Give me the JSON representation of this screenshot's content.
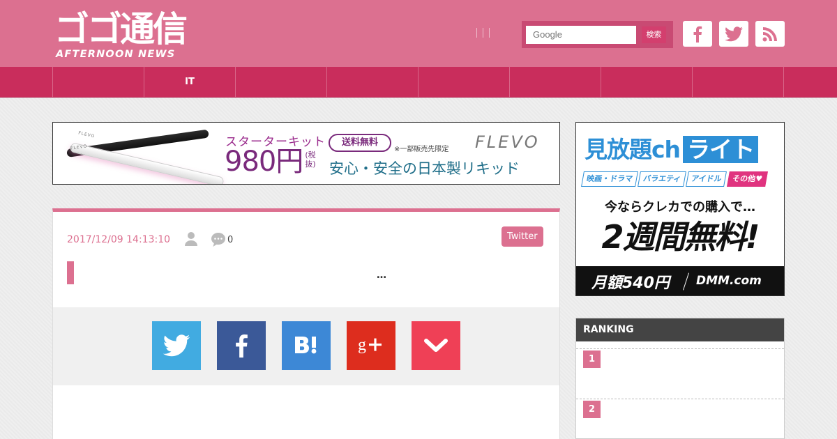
{
  "brand": {
    "logo_jp": "ゴゴ通信",
    "logo_en": "AFTERNOON NEWS"
  },
  "search": {
    "placeholder": "Google",
    "button_label": "検索"
  },
  "social_links": [
    {
      "name": "facebook",
      "icon": "facebook-icon"
    },
    {
      "name": "twitter",
      "icon": "twitter-icon"
    },
    {
      "name": "rss",
      "icon": "rss-icon"
    }
  ],
  "nav": {
    "items": [
      "",
      "IT",
      "",
      "",
      "",
      "",
      "",
      "",
      ""
    ]
  },
  "ads": {
    "banner": {
      "pen_label": "FLEVO",
      "kit_label": "スターターキット",
      "price": "980円",
      "tax_note": "(税抜)",
      "free_shipping": "送料無料",
      "limited_note": "※一部販売先限定",
      "brand": "FLEVO",
      "tagline": "安心・安全の日本製リキッド"
    },
    "side": {
      "title_main": "見放題ch",
      "title_lite": "ライト",
      "tags": [
        "映画・ドラマ",
        "バラエティ",
        "アイドル",
        "その他♥"
      ],
      "offer_line": "今ならクレカでの購入で…",
      "big_line": "2週間無料!",
      "monthly_price": "月額540円",
      "provider": "DMM.com"
    }
  },
  "article": {
    "date": "2017/12/09 14:13:10",
    "comment_count": "0",
    "source_tag": "Twitter",
    "title": "…"
  },
  "share_buttons": [
    {
      "name": "twitter",
      "icon": "twitter-icon",
      "color": "#41abe1"
    },
    {
      "name": "facebook",
      "icon": "facebook-icon",
      "color": "#3b5998"
    },
    {
      "name": "hatena",
      "icon": "hatena-bookmark-icon",
      "color": "#3d88d6"
    },
    {
      "name": "google-plus",
      "icon": "google-plus-icon",
      "color": "#dd2d1e"
    },
    {
      "name": "pocket",
      "icon": "pocket-icon",
      "color": "#ef4056"
    }
  ],
  "ranking": {
    "title": "RANKING",
    "items": [
      {
        "rank": "1",
        "title": ""
      },
      {
        "rank": "2",
        "title": ""
      }
    ]
  },
  "colors": {
    "header_pink": "#dc7090",
    "nav_crimson": "#c92d5c",
    "accent": "#dc7090",
    "ranking_head": "#444444"
  }
}
